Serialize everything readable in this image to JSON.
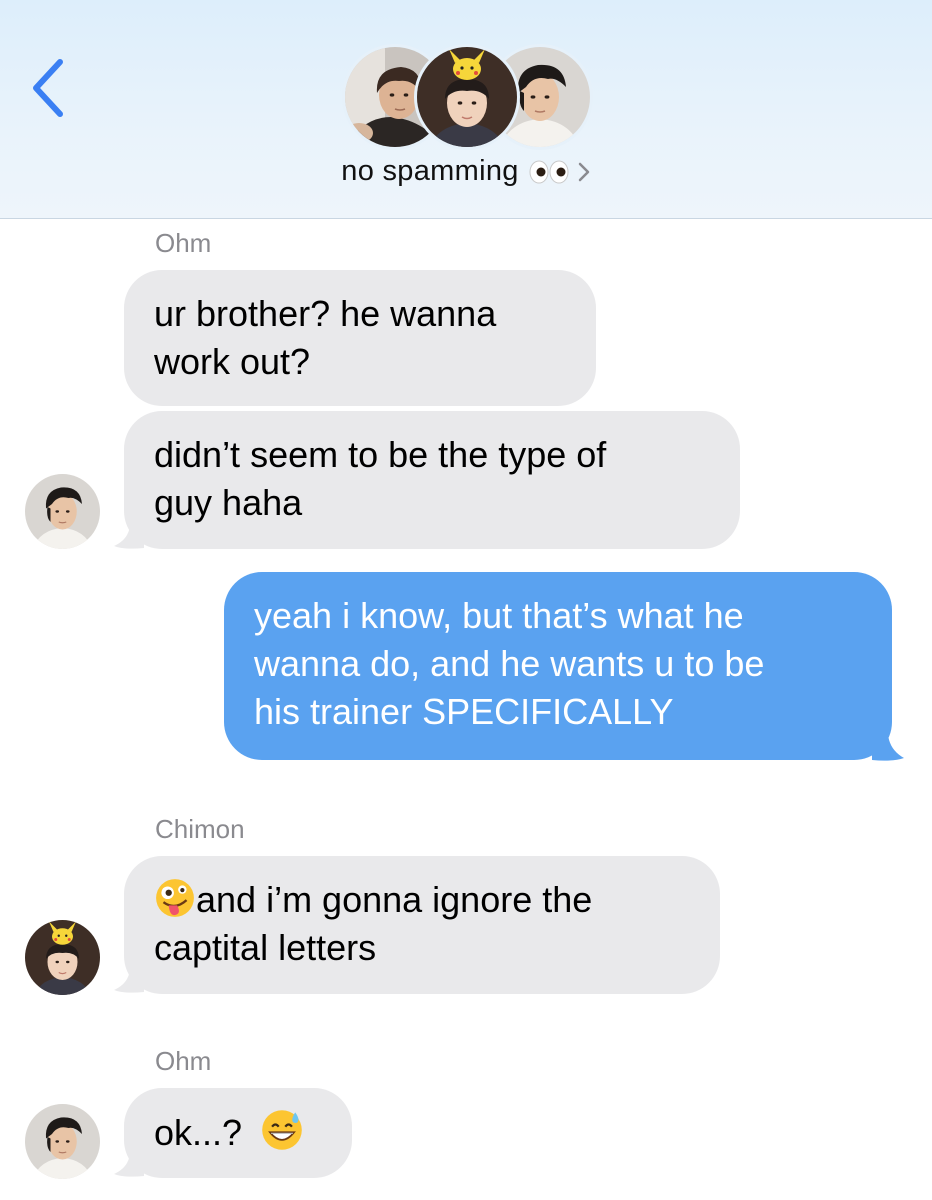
{
  "header": {
    "group_name": "no spamming",
    "title_emoji": "eyes-emoji",
    "back_icon": "chevron-left-icon",
    "accent": "#3a7ff3"
  },
  "messages": [
    {
      "sender": "Ohm",
      "direction": "in",
      "lines": [
        "ur brother? he wanna",
        "work out?"
      ]
    },
    {
      "direction": "in",
      "lines": [
        "didn’t seem to be the type of",
        "guy haha"
      ],
      "avatar": "ohm-avatar"
    },
    {
      "direction": "out",
      "lines": [
        "yeah i know, but that’s what he",
        "wanna do, and he wants u to be",
        "his trainer SPECIFICALLY"
      ]
    },
    {
      "sender": "Chimon",
      "direction": "in",
      "emoji": "zany-face-emoji",
      "lines": [
        "and i’m gonna ignore the",
        "captital letters"
      ],
      "avatar": "chimon-avatar"
    },
    {
      "sender": "Ohm",
      "direction": "in",
      "text": "ok...?",
      "emoji": "grinning-sweat-emoji",
      "avatar": "ohm-avatar"
    }
  ],
  "colors": {
    "incoming_bubble": "#e9e9eb",
    "outgoing_bubble": "#5aa2f0",
    "sender_label": "#8a8a8f"
  }
}
